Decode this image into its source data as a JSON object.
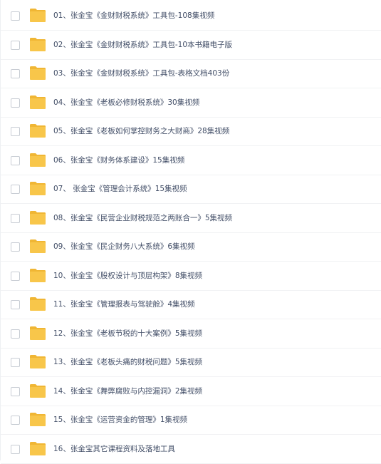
{
  "files": [
    {
      "name": "01、张金宝《金财财税系统》工具包-108集视频",
      "icon": "folder-icon"
    },
    {
      "name": "02、张金宝《金财财税系统》工具包-10本书籍电子版",
      "icon": "folder-icon"
    },
    {
      "name": "03、张金宝《金财财税系统》工具包-表格文档403份",
      "icon": "folder-icon"
    },
    {
      "name": "04、张金宝《老板必修财税系统》30集视频",
      "icon": "folder-icon"
    },
    {
      "name": "05、张金宝《老板如何掌控财务之大财商》28集视频",
      "icon": "folder-icon"
    },
    {
      "name": "06、张金宝《财务体系建设》15集视频",
      "icon": "folder-icon"
    },
    {
      "name": "07、 张金宝《管理会计系统》15集视频",
      "icon": "folder-icon"
    },
    {
      "name": "08、张金宝《民营企业财税规范之两账合一》5集视频",
      "icon": "folder-icon"
    },
    {
      "name": "09、张金宝《民企财务八大系统》6集视频",
      "icon": "folder-icon"
    },
    {
      "name": "10、张金宝《股权设计与顶层构架》8集视频",
      "icon": "folder-icon"
    },
    {
      "name": "11、张金宝《管理报表与驾驶舱》4集视频",
      "icon": "folder-icon"
    },
    {
      "name": "12、张金宝《老板节税的十大案例》5集视频",
      "icon": "folder-icon"
    },
    {
      "name": "13、张金宝《老板头痛的财税问题》5集视频",
      "icon": "folder-icon"
    },
    {
      "name": "14、张金宝《舞弊腐败与内控漏洞》2集视频",
      "icon": "folder-icon"
    },
    {
      "name": "15、张金宝《运营资金的管理》1集视频",
      "icon": "folder-icon"
    },
    {
      "name": "16、张金宝其它课程资料及落地工具",
      "icon": "folder-icon"
    }
  ],
  "colors": {
    "folder": "#f8c64a",
    "folder_tab": "#f0b634",
    "text": "#424e67",
    "checkbox_border": "#c8cdd4",
    "divider": "#f1f2f4"
  }
}
